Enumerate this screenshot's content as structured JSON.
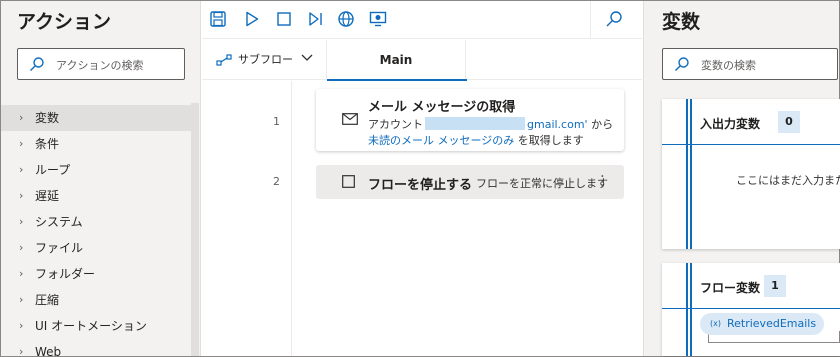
{
  "actions_pane": {
    "title": "アクション",
    "search_placeholder": "アクションの検索",
    "items": [
      {
        "label": "変数",
        "selected": true
      },
      {
        "label": "条件"
      },
      {
        "label": "ループ"
      },
      {
        "label": "遅延"
      },
      {
        "label": "システム"
      },
      {
        "label": "ファイル"
      },
      {
        "label": "フォルダー"
      },
      {
        "label": "圧縮"
      },
      {
        "label": "UI オートメーション"
      },
      {
        "label": "Web"
      }
    ]
  },
  "toolbar": {
    "icons": [
      "save-icon",
      "run-icon",
      "stop-icon",
      "run-next-action-icon",
      "web-recorder-icon",
      "desktop-recorder-icon",
      "search-icon"
    ]
  },
  "designer": {
    "subflow_label": "サブフロー",
    "main_tab": "Main",
    "steps": [
      {
        "line": "1",
        "icon": "mail-icon",
        "title": "メール メッセージの取得",
        "desc_prefix": "アカウント",
        "desc_account_suffix": "gmail.com'",
        "desc_from": "から",
        "desc_link": "未読のメール メッセージのみ",
        "desc_end": "を取得します"
      },
      {
        "line": "2",
        "icon": "stop-square-icon",
        "title": "フローを停止する",
        "desc": "フローを正常に停止します"
      }
    ]
  },
  "variables_pane": {
    "title": "変数",
    "search_placeholder": "変数の検索",
    "io_label": "入出力変数",
    "io_count": "0",
    "io_empty": "ここにはまだ入力または",
    "flow_label": "フロー変数",
    "flow_count": "1",
    "flow_vars": [
      {
        "prefix": "(x)",
        "name": "RetrievedEmails"
      }
    ]
  },
  "colors": {
    "accent": "#0f6cbd",
    "pane_bg": "#f3f2f1"
  }
}
